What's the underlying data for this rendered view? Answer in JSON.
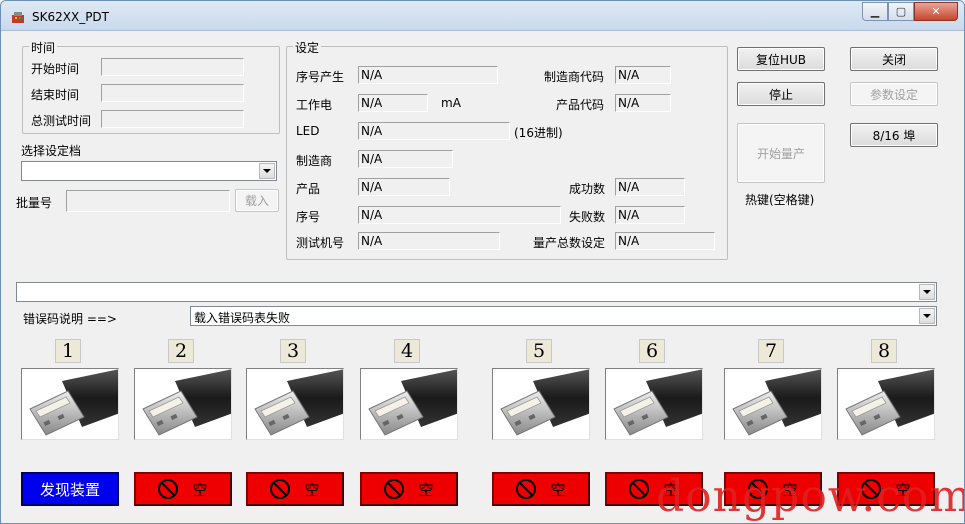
{
  "window": {
    "title": "SK62XX_PDT"
  },
  "time_group": {
    "title": "时间",
    "start_label": "开始时间",
    "end_label": "结束时间",
    "total_label": "总测试时间"
  },
  "profile": {
    "label": "选择设定档",
    "value": ""
  },
  "batch": {
    "label": "批量号",
    "value": "",
    "load_button": "载入"
  },
  "settings": {
    "title": "设定",
    "serial_gen_label": "序号产生",
    "serial_gen": "N/A",
    "current_label": "工作电",
    "current": "N/A",
    "current_unit": "mA",
    "led_label": "LED",
    "led": "N/A",
    "led_unit": "(16进制)",
    "vendor_label": "制造商",
    "vendor": "N/A",
    "product_label": "产品",
    "product": "N/A",
    "serial_label": "序号",
    "serial": "N/A",
    "tester_label": "测试机号",
    "tester": "N/A",
    "vendor_code_label": "制造商代码",
    "vendor_code": "N/A",
    "product_code_label": "产品代码",
    "product_code": "N/A",
    "success_label": "成功数",
    "success": "N/A",
    "fail_label": "失败数",
    "fail": "N/A",
    "total_label": "量产总数设定",
    "total": "N/A"
  },
  "buttons": {
    "reset_hub": "复位HUB",
    "close": "关闭",
    "stop": "停止",
    "params": "参数设定",
    "start": "开始量产",
    "ports_mode": "8/16 埠",
    "hotkey": "热键(空格键)"
  },
  "error": {
    "label": "错误码说明 ==>",
    "value": "载入错误码表失败",
    "top_value": ""
  },
  "ports": [
    {
      "num": "1",
      "status": "发现装置",
      "state": "found"
    },
    {
      "num": "2",
      "status": "空",
      "state": "empty"
    },
    {
      "num": "3",
      "status": "空",
      "state": "empty"
    },
    {
      "num": "4",
      "status": "空",
      "state": "empty"
    },
    {
      "num": "5",
      "status": "空",
      "state": "empty"
    },
    {
      "num": "6",
      "status": "空",
      "state": "empty"
    },
    {
      "num": "7",
      "status": "空",
      "state": "empty"
    },
    {
      "num": "8",
      "status": "空",
      "state": "empty"
    }
  ],
  "watermark": "dongpow.com",
  "colors": {
    "found": "#0000ee",
    "empty": "#ee0000"
  }
}
